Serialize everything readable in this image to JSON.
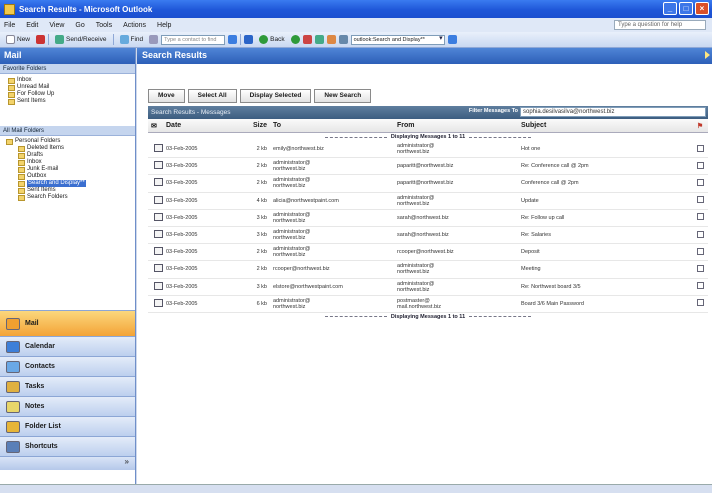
{
  "window": {
    "title": "Search Results - Microsoft Outlook"
  },
  "menubar": {
    "items": [
      "File",
      "Edit",
      "View",
      "Go",
      "Tools",
      "Actions",
      "Help"
    ],
    "help_placeholder": "Type a question for help"
  },
  "toolbar": {
    "new_label": "New",
    "send_receive_label": "Send/Receive",
    "find_label": "Find",
    "contact_placeholder": "Type a contact to find",
    "back_label": "Back",
    "address_value": "outlook:Search and Display**"
  },
  "nav": {
    "header": "Mail",
    "favorites_label": "Favorite Folders",
    "favorites": [
      "Inbox",
      "Unread Mail",
      "For Follow Up",
      "Sent Items"
    ],
    "all_folders_label": "All Mail Folders",
    "tree": [
      {
        "label": "Personal Folders",
        "indent": 0,
        "selected": false
      },
      {
        "label": "Deleted Items",
        "indent": 1,
        "selected": false
      },
      {
        "label": "Drafts",
        "indent": 1,
        "selected": false
      },
      {
        "label": "Inbox",
        "indent": 1,
        "selected": false
      },
      {
        "label": "Junk E-mail",
        "indent": 1,
        "selected": false
      },
      {
        "label": "Outbox",
        "indent": 1,
        "selected": false
      },
      {
        "label": "Search and Display**",
        "indent": 1,
        "selected": true
      },
      {
        "label": "Sent Items",
        "indent": 1,
        "selected": false
      },
      {
        "label": "Search Folders",
        "indent": 1,
        "selected": false
      }
    ],
    "buttons": [
      {
        "label": "Mail",
        "color": "#f0a030",
        "active": true
      },
      {
        "label": "Calendar",
        "color": "#3d7fd9",
        "active": false
      },
      {
        "label": "Contacts",
        "color": "#6aa8e6",
        "active": false
      },
      {
        "label": "Tasks",
        "color": "#e0b040",
        "active": false
      },
      {
        "label": "Notes",
        "color": "#e8d66a",
        "active": false
      },
      {
        "label": "Folder List",
        "color": "#e7b538",
        "active": false
      },
      {
        "label": "Shortcuts",
        "color": "#5a7fb8",
        "active": false
      }
    ]
  },
  "main": {
    "header": "Search Results",
    "actions": [
      "Move",
      "Select All",
      "Display Selected",
      "New Search"
    ],
    "panel_title": "Search Results - Messages",
    "filter_label": "Filter Messages To",
    "filter_value": "sophia.desilvasilva@northwest.biz",
    "columns": {
      "date": "Date",
      "size": "Size",
      "to": "To",
      "from": "From",
      "subject": "Subject"
    },
    "displaying": "Displaying Messages 1 to 11",
    "rows": [
      {
        "date": "03-Feb-2005",
        "size": "2 kb",
        "to": "emily@northwest.biz",
        "from1": "administrator@",
        "from2": "northwest.biz",
        "subject": "Hot one"
      },
      {
        "date": "03-Feb-2005",
        "size": "2 kb",
        "to1": "administrator@",
        "to2": "northwest.biz",
        "from": "paparitt@northwest.biz",
        "subject": "Re: Conference call @ 2pm"
      },
      {
        "date": "03-Feb-2005",
        "size": "2 kb",
        "to1": "administrator@",
        "to2": "northwest.biz",
        "from": "paparitt@northwest.biz",
        "subject": "Conference call @ 2pm"
      },
      {
        "date": "03-Feb-2005",
        "size": "4 kb",
        "to": "alicia@northwestpaint.com",
        "from1": "administrator@",
        "from2": "northwest.biz",
        "subject": "Update"
      },
      {
        "date": "03-Feb-2005",
        "size": "3 kb",
        "to1": "administrator@",
        "to2": "northwest.biz",
        "from": "sarah@northwest.biz",
        "subject": "Re: Follow up call"
      },
      {
        "date": "03-Feb-2005",
        "size": "3 kb",
        "to1": "administrator@",
        "to2": "northwest.biz",
        "from": "sarah@northwest.biz",
        "subject": "Re: Salaries"
      },
      {
        "date": "03-Feb-2005",
        "size": "2 kb",
        "to1": "administrator@",
        "to2": "northwest.biz",
        "from": "rcooper@northwest.biz",
        "subject": "Deposit"
      },
      {
        "date": "03-Feb-2005",
        "size": "2 kb",
        "to": "rcooper@northwest.biz",
        "from1": "administrator@",
        "from2": "northwest.biz",
        "subject": "Meeting"
      },
      {
        "date": "03-Feb-2005",
        "size": "3 kb",
        "to": "elstore@northwestpaint.com",
        "from1": "administrator@",
        "from2": "northwest.biz",
        "subject": "Re: Northwest board 3/5"
      },
      {
        "date": "03-Feb-2005",
        "size": "6 kb",
        "to1": "administrator@",
        "to2": "northwest.biz",
        "from1": "postmaster@",
        "from2": "mail.northwest.biz",
        "subject": "Board 3/6 Main Password"
      }
    ]
  }
}
